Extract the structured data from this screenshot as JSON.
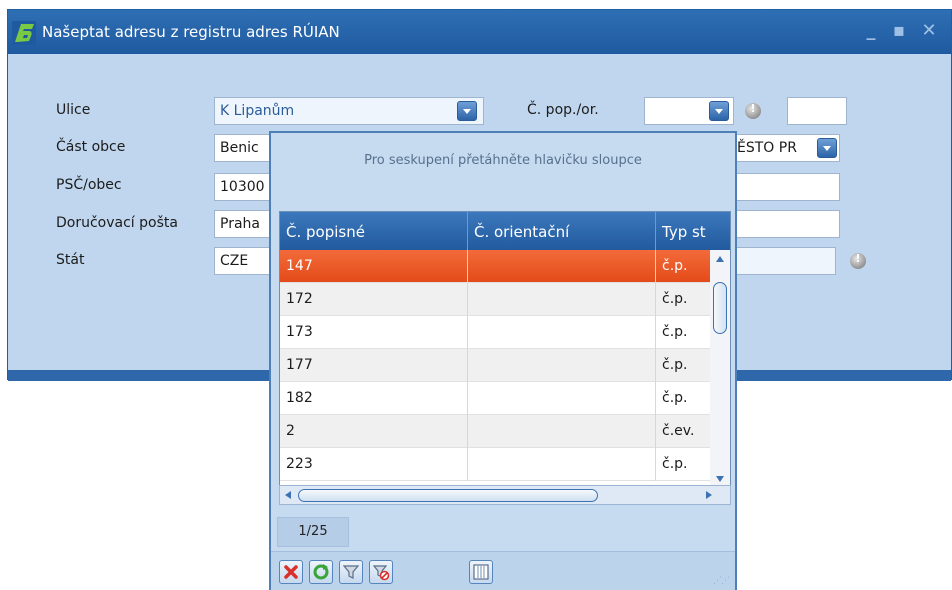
{
  "window": {
    "title": "Našeptat adresu z registru adres RÚIAN",
    "controls": [
      "minimize-icon",
      "maximize-icon",
      "close-icon"
    ]
  },
  "form": {
    "ulice": {
      "label": "Ulice",
      "value": "K Lipanům"
    },
    "cislo": {
      "label": "Č. pop./or.",
      "value": ""
    },
    "cast_obce": {
      "label": "Část obce",
      "value": "Benic",
      "right_value": "ĚSTO PR"
    },
    "psc_obec": {
      "label": "PSČ/obec",
      "value": "10300"
    },
    "dorucovaci_posta": {
      "label": "Doručovací pošta",
      "value": "Praha"
    },
    "stat": {
      "label": "Stát",
      "value": "CZE"
    }
  },
  "popup": {
    "group_hint": "Pro seskupení přetáhněte hlavičku sloupce",
    "columns": [
      "Č. popisné",
      "Č. orientační",
      "Typ st"
    ],
    "rows": [
      {
        "popisne": "147",
        "orientacni": "",
        "typ": "č.p.",
        "selected": true
      },
      {
        "popisne": "172",
        "orientacni": "",
        "typ": "č.p."
      },
      {
        "popisne": "173",
        "orientacni": "",
        "typ": "č.p."
      },
      {
        "popisne": "177",
        "orientacni": "",
        "typ": "č.p."
      },
      {
        "popisne": "182",
        "orientacni": "",
        "typ": "č.p."
      },
      {
        "popisne": "2",
        "orientacni": "",
        "typ": "č.ev."
      },
      {
        "popisne": "223",
        "orientacni": "",
        "typ": "č.p."
      }
    ],
    "pager": "1/25",
    "toolbar": [
      "cancel-icon",
      "refresh-icon",
      "filter-icon",
      "clear-filter-icon",
      "columns-icon"
    ]
  },
  "colors": {
    "accent": "#2f6fb4",
    "selection": "#ec5a27",
    "grid_header": "#2c66aa"
  }
}
